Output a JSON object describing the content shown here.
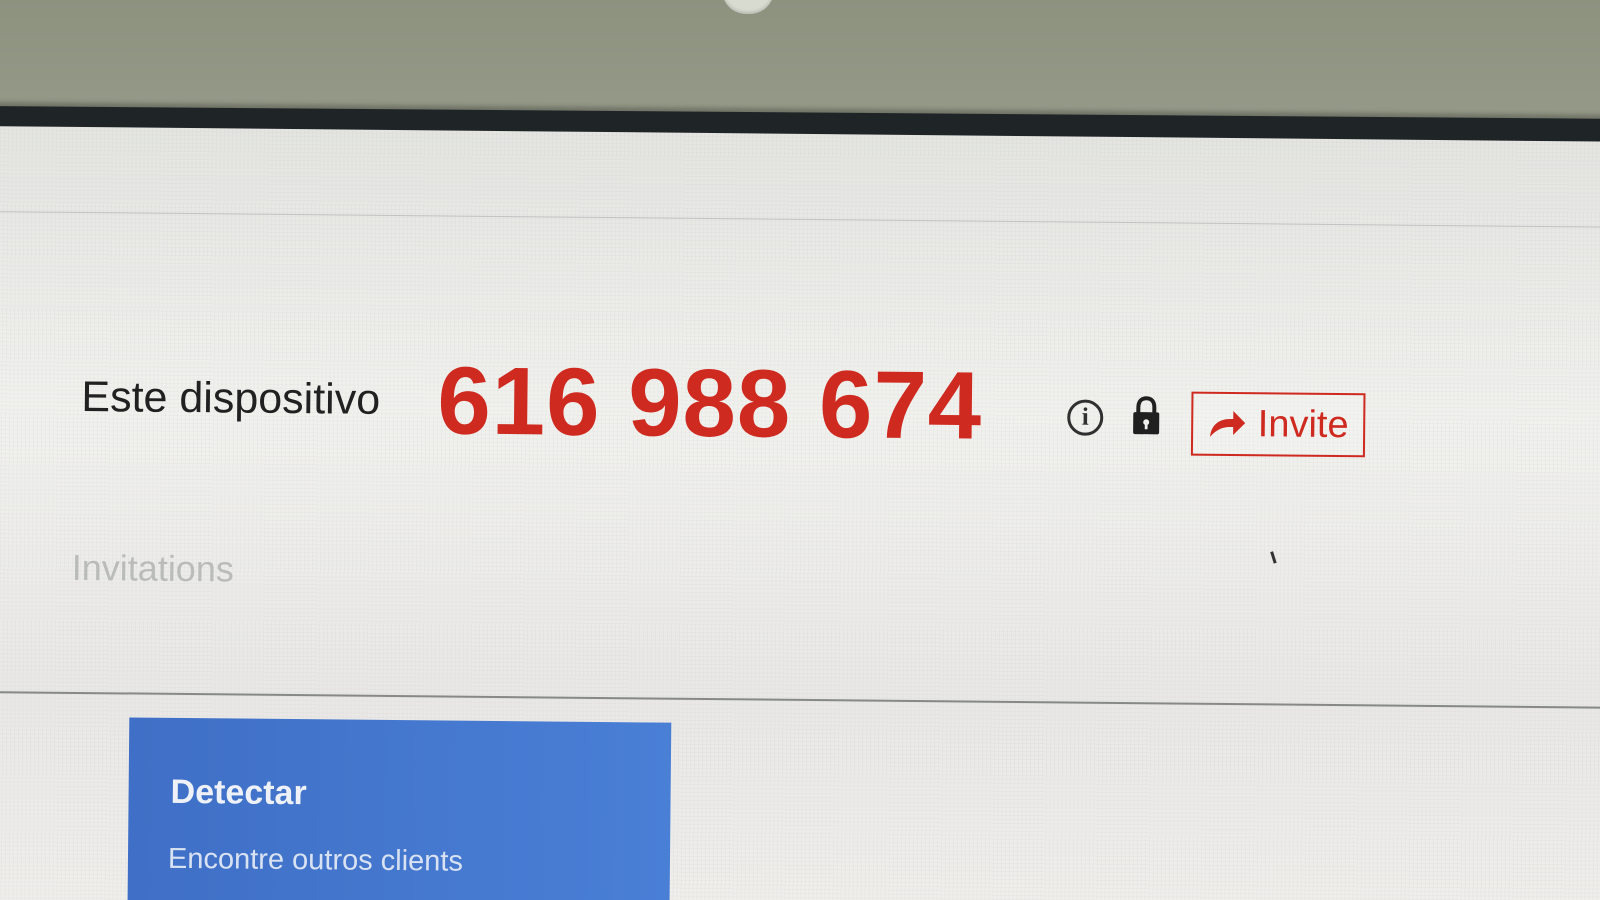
{
  "device": {
    "label": "Este dispositivo",
    "id": "616 988 674"
  },
  "actions": {
    "info_icon": "info-icon",
    "lock_icon": "lock-icon",
    "invite_icon": "share-arrow-icon",
    "invite_label": "Invite"
  },
  "invitations": {
    "heading": "Invitations"
  },
  "detect": {
    "title": "Detectar",
    "subtitle": "Encontre outros clients"
  },
  "colors": {
    "device_id": "#cf2a20",
    "invite_border": "#cf2a20",
    "detect_card": "#4a7fd6"
  }
}
